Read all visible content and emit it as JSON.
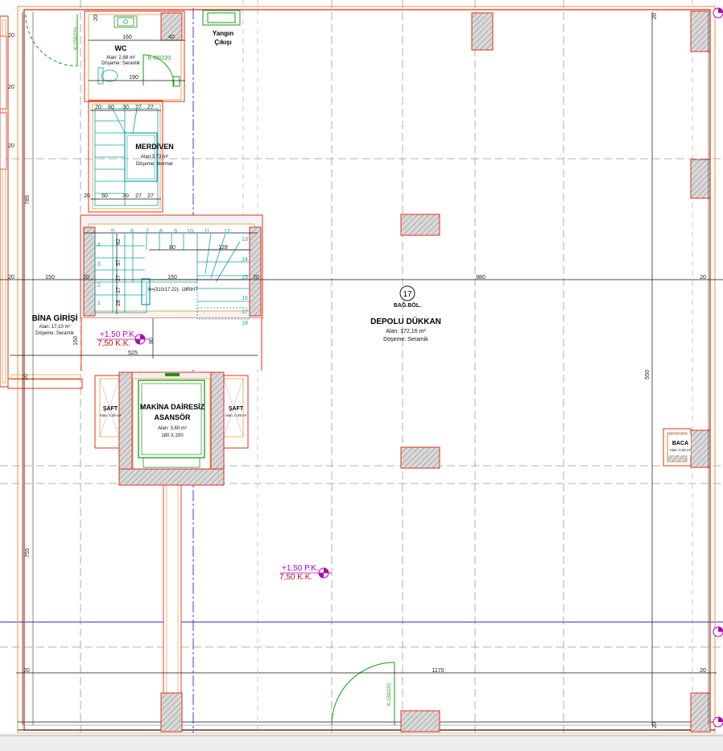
{
  "colors": {
    "wall_fill": "#f0f0f0",
    "wall_red": "#e0301e",
    "wall_orange": "#e8a040",
    "column_hatch": "#888888",
    "grid_dash": "#9a9a9a",
    "dim_line": "#111111",
    "axis_blue": "#2b2bcc",
    "door_green": "#1a9a1a",
    "stair_teal": "#16a0a0",
    "level_magenta": "#b400b4",
    "level_red": "#cc1010"
  },
  "rooms": {
    "wc": {
      "name": "WC",
      "area": "Alan: 2,88 m²",
      "floor": "Döşeme: Seramik"
    },
    "stairs": {
      "name": "MERDİVEN",
      "area": "Alan:3,73 m²",
      "floor": "Döşeme: Mermer"
    },
    "entrance": {
      "name": "BİNA GİRİŞİ",
      "area": "Alan: 17,10 m²",
      "floor": "Döşeme: Seramik"
    },
    "shop": {
      "number": "17",
      "subtitle": "BAĞ.BÖL.",
      "name": "DEPOLU DÜKKAN",
      "area": "Alan: 172,16 m²",
      "floor": "Döşeme: Seramik"
    },
    "elevator": {
      "name_line1": "MAKİNA DAİRESİZ",
      "name_line2": "ASANSÖR",
      "area": "Alan: 3,60 m²",
      "size": "180 X 200"
    },
    "shaft_left": {
      "name": "ŞAFT",
      "area": "Alan: 0,49 m²"
    },
    "shaft_right": {
      "name": "ŞAFT",
      "area": "Alan: 0,49 m²"
    },
    "chimney": {
      "name": "BACA",
      "area": "Alan: 0,30 m²"
    }
  },
  "labels": {
    "fire_exit_line1": "Yangın",
    "fire_exit_line2": "Çıkışı",
    "stair_formula": "h=(310/17,22)· 18RIHT",
    "door_wc": "K-80/220",
    "door_left": "K-150/220",
    "door_shop": "K-150/220"
  },
  "levels": [
    {
      "pk": "+1,50 P.K.",
      "kk": "7,50 K.K."
    },
    {
      "pk": "+1,50 P.K.",
      "kk": "7,50 K.K."
    }
  ],
  "dimensions": {
    "wc_width": "160",
    "wc_right": "40",
    "wc_bottom": "190",
    "stair_top": [
      "20",
      "60",
      "30",
      "27",
      "27"
    ],
    "stair_bottom": [
      "20",
      "60",
      "30",
      "27",
      "27"
    ],
    "upper_steps": [
      "5",
      "6",
      "7",
      "8",
      "9",
      "10",
      "11",
      "12"
    ],
    "right_steps": [
      "13",
      "14",
      "15",
      "16",
      "17",
      "18"
    ],
    "left_steps": [
      "4",
      "3",
      "2",
      "1"
    ],
    "left_stair_dims": [
      "62",
      "57",
      "27",
      "27",
      "28"
    ],
    "stair_mid": [
      "80",
      "128",
      "150"
    ],
    "left_20_a": "20",
    "left_20_b": "20",
    "left_20_c": "20",
    "left_20_d": "20",
    "left_785": "785",
    "left_755": "755",
    "width_150": "150",
    "width_20": "20",
    "width_525": "525",
    "dim_150v": "150",
    "dim_80v": "80",
    "shop_980": "980",
    "shop_20": "20",
    "right_20a": "20",
    "right_20b": "20",
    "right_20c": "20",
    "right_20d": "20",
    "right_550": "550",
    "bottom_1170": "1170",
    "bottom_20": "20",
    "wc_top_20": "20",
    "wc_top_30": "20"
  }
}
